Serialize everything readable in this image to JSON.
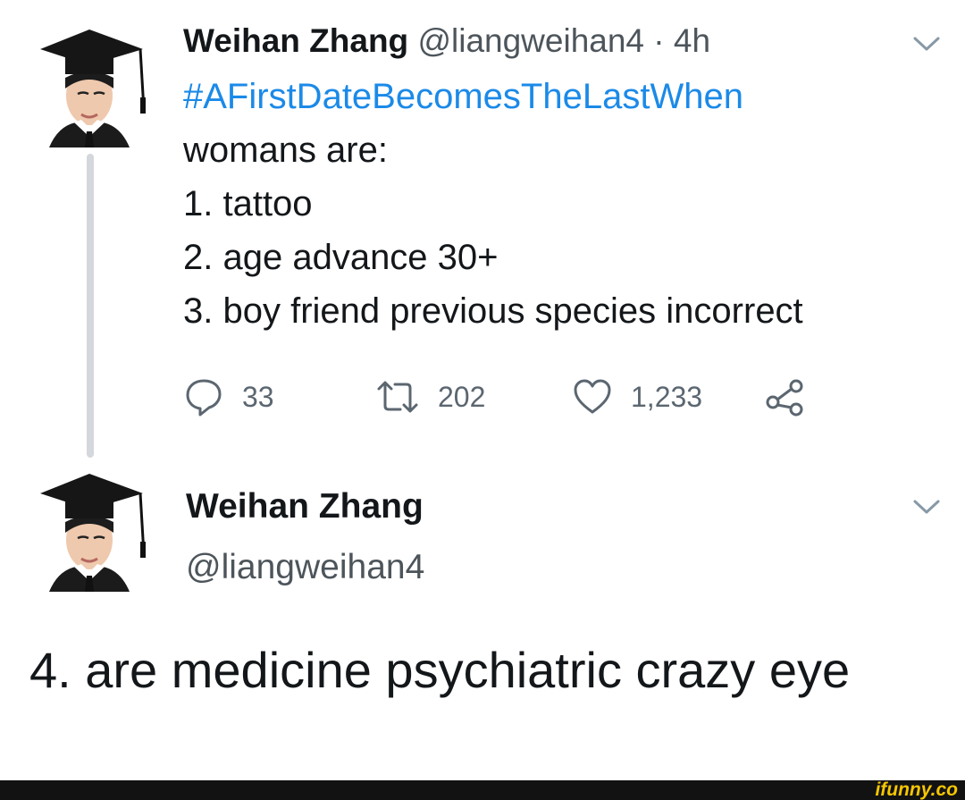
{
  "tweet1": {
    "name": "Weihan Zhang",
    "handle": "@liangweihan4",
    "time": "· 4h",
    "hashtag": "#AFirstDateBecomesTheLastWhen",
    "lines": [
      "womans are:",
      "1. tattoo",
      "2. age advance 30+",
      "3. boy friend previous species incorrect"
    ],
    "actions": {
      "replies": "33",
      "retweets": "202",
      "likes": "1,233"
    }
  },
  "tweet2": {
    "name": "Weihan Zhang",
    "handle": "@liangweihan4",
    "body": "4. are medicine psychiatric crazy eye"
  },
  "watermark": "ifunny.co",
  "colors": {
    "hashtag": "#1b8ae8",
    "muted": "#5b6670",
    "thread_line": "#d4d8dc",
    "watermark": "#f6c600"
  },
  "icons": [
    "chevron-down-icon",
    "reply-icon",
    "retweet-icon",
    "like-icon",
    "share-icon"
  ]
}
